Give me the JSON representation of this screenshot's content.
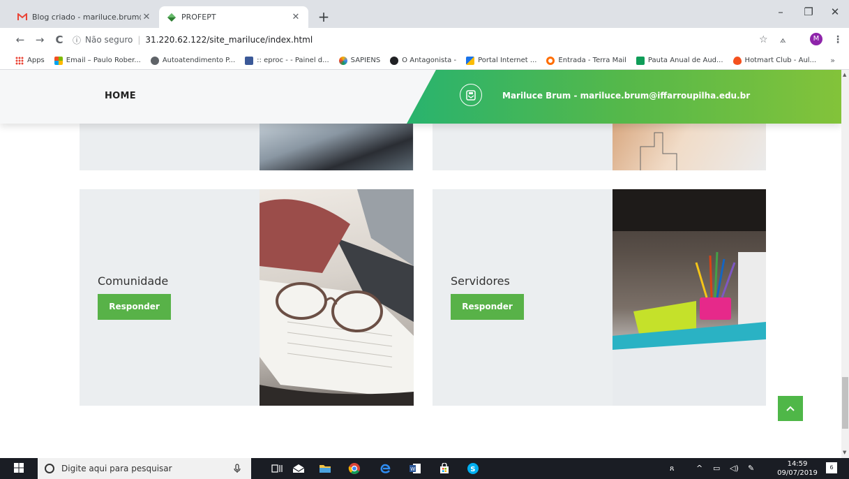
{
  "browser": {
    "tabs": [
      {
        "title": "Blog criado - mariluce.brum@iffa",
        "active": false
      },
      {
        "title": "PROFEPT",
        "active": true
      }
    ],
    "new_tab": "+",
    "window_controls": {
      "minimize": "–",
      "restore": "❐",
      "close": "✕"
    },
    "nav": {
      "back": "←",
      "forward": "→",
      "reload": "C"
    },
    "address": {
      "security_label": "Não seguro",
      "separator": "|",
      "url": "31.220.62.122/site_mariluce/index.html"
    },
    "profile_initial": "M",
    "bookmarks": [
      {
        "label": "Apps",
        "color": "#ea4335"
      },
      {
        "label": "Email – Paulo Rober...",
        "color": "#f25022"
      },
      {
        "label": "Autoatendimento P...",
        "color": "#5f6368"
      },
      {
        "label": ":: eproc - - Painel d...",
        "color": "#3b5998"
      },
      {
        "label": "SAPIENS",
        "color": "#f4b400"
      },
      {
        "label": "O Antagonista -",
        "color": "#202124"
      },
      {
        "label": "Portal Internet ...",
        "color": "#1a73e8"
      },
      {
        "label": "Entrada - Terra Mail",
        "color": "#ff6d00"
      },
      {
        "label": "Pauta Anual de Aud...",
        "color": "#0f9d58"
      },
      {
        "label": "Hotmart Club - Aul...",
        "color": "#f4511e"
      }
    ],
    "bookmarks_more": "»"
  },
  "site": {
    "nav_home": "HOME",
    "contact": "Mariluce Brum - mariluce.brum@iffarroupilha.edu.br",
    "cards": [
      {
        "label": "Comunidade",
        "button": "Responder"
      },
      {
        "label": "Servidores",
        "button": "Responder"
      }
    ],
    "back_to_top": "^"
  },
  "taskbar": {
    "search_placeholder": "Digite aqui para pesquisar",
    "time": "14:59",
    "date": "09/07/2019",
    "notification_count": "6"
  }
}
